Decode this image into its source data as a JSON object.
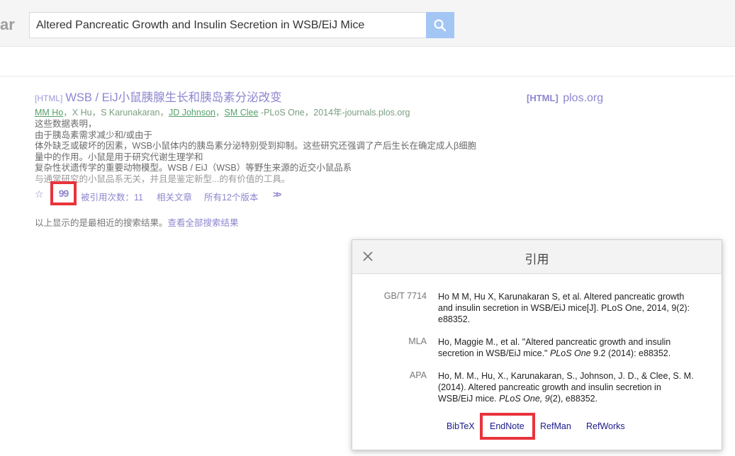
{
  "header": {
    "logo_fragment": "ar",
    "search_value": "Altered Pancreatic Growth and Insulin Secretion in WSB/EiJ Mice"
  },
  "result": {
    "tag": "[HTML]",
    "title": "WSB / EiJ小鼠胰腺生长和胰岛素分泌改变",
    "authors": {
      "a1": "MM Ho",
      "s1": "，X Hu，S Karunakaran，",
      "a2": "JD Johnson",
      "s2": "，",
      "a3": "SM Clee",
      "source": " -PLoS One，2014年-journals.plos.org"
    },
    "snippet": [
      "这些数据表明，",
      "由于胰岛素需求减少和/或由于",
      "体外缺乏或破坏的因素，WSB小鼠体内的胰岛素分泌特别受到抑制。这些研究还强调了产后生长在确定成人β细胞",
      "量中的作用。小鼠是用于研究代谢生理学和",
      "复杂性状遗传学的重要动物模型。WSB / EiJ（WSB）等野生来源的近交小鼠品系",
      "与通常研究的小鼠品系无关，并且是鉴定新型...的有价值的工具。"
    ],
    "actions": {
      "cited_by": "被引用次数：11",
      "related": "相关文章",
      "versions": "所有12个版本"
    },
    "footer_text": "以上显示的是最相近的搜索结果。",
    "footer_link": "查看全部搜索结果"
  },
  "side": {
    "tag": "[HTML]",
    "source": "plos.org"
  },
  "cite_dialog": {
    "title": "引用",
    "rows": [
      {
        "label": "GB/T 7714",
        "text": "Ho M M, Hu X, Karunakaran S, et al. Altered pancreatic growth and insulin secretion in WSB/EiJ mice[J]. PLoS One, 2014, 9(2): e88352."
      },
      {
        "label": "MLA",
        "pre": "Ho, Maggie M., et al. \"Altered pancreatic growth and insulin secretion in WSB/EiJ mice.\" ",
        "italic": "PLoS One",
        "post": " 9.2 (2014): e88352."
      },
      {
        "label": "APA",
        "pre": "Ho, M. M., Hu, X., Karunakaran, S., Johnson, J. D., & Clee, S. M. (2014). Altered pancreatic growth and insulin secretion in WSB/EiJ mice. ",
        "italic": "PLoS One, 9",
        "post": "(2), e88352."
      }
    ],
    "exports": [
      "BibTeX",
      "EndNote",
      "RefMan",
      "RefWorks"
    ]
  },
  "colors": {
    "link": "#8d86cf",
    "highlight": "#e8333b",
    "author_green": "#55a06a",
    "search_button": "#a4c6f5"
  }
}
